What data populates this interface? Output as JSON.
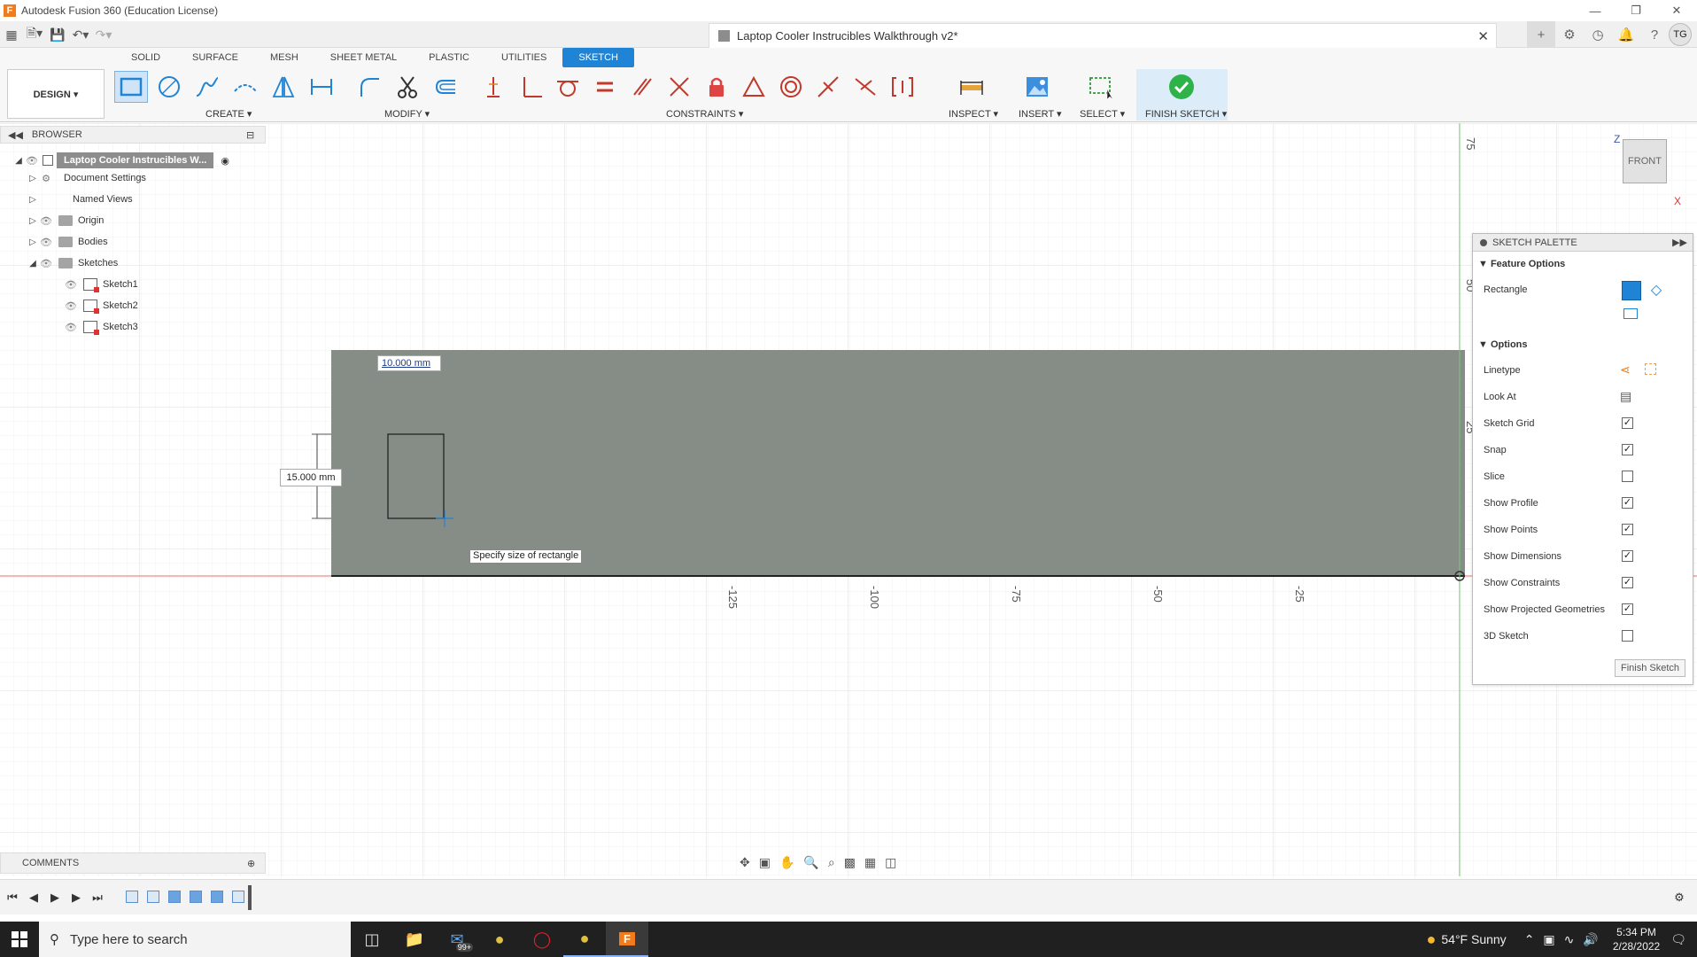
{
  "window": {
    "app_title": "Autodesk Fusion 360 (Education License)",
    "logo_letter": "F",
    "doc_title": "Laptop Cooler Instrucibles Walkthrough v2*",
    "user_initials": "TG"
  },
  "ribbon": {
    "workspace_tabs": [
      "SOLID",
      "SURFACE",
      "MESH",
      "SHEET METAL",
      "PLASTIC",
      "UTILITIES",
      "SKETCH"
    ],
    "active_tab": "SKETCH",
    "design_label": "DESIGN ▾",
    "groups": {
      "create": "CREATE ▾",
      "modify": "MODIFY ▾",
      "constraints": "CONSTRAINTS ▾",
      "inspect": "INSPECT ▾",
      "insert": "INSERT ▾",
      "select": "SELECT ▾",
      "finish": "FINISH SKETCH ▾"
    }
  },
  "browser": {
    "header": "BROWSER",
    "root": "Laptop Cooler Instrucibles W...",
    "items": [
      "Document Settings",
      "Named Views",
      "Origin",
      "Bodies",
      "Sketches"
    ],
    "sketches": [
      "Sketch1",
      "Sketch2",
      "Sketch3"
    ]
  },
  "canvas": {
    "dim_width": "10.000 mm",
    "dim_height": "15.000 mm",
    "tooltip": "Specify size of rectangle",
    "x_ticks": [
      "-125",
      "-100",
      "-75",
      "-50",
      "-25"
    ],
    "y_ticks": [
      "75",
      "50",
      "25"
    ],
    "view_cube": "FRONT",
    "axis_z": "Z",
    "axis_x": "X"
  },
  "palette": {
    "header": "SKETCH PALETTE",
    "feature_options": "Feature Options",
    "rectangle_label": "Rectangle",
    "options_label": "Options",
    "rows": [
      {
        "label": "Linetype",
        "type": "icons"
      },
      {
        "label": "Look At",
        "type": "icon"
      },
      {
        "label": "Sketch Grid",
        "checked": true
      },
      {
        "label": "Snap",
        "checked": true
      },
      {
        "label": "Slice",
        "checked": false
      },
      {
        "label": "Show Profile",
        "checked": true
      },
      {
        "label": "Show Points",
        "checked": true
      },
      {
        "label": "Show Dimensions",
        "checked": true
      },
      {
        "label": "Show Constraints",
        "checked": true
      },
      {
        "label": "Show Projected Geometries",
        "checked": true
      },
      {
        "label": "3D Sketch",
        "checked": false
      }
    ],
    "finish_button": "Finish Sketch"
  },
  "comments": {
    "label": "COMMENTS"
  },
  "taskbar": {
    "search_placeholder": "Type here to search",
    "badge": "99+",
    "weather": "54°F  Sunny",
    "time": "5:34 PM",
    "date": "2/28/2022"
  },
  "colors": {
    "accent": "#1f84d6",
    "profile_fill": "#7f8680",
    "finish_green": "#2fb24a",
    "taskbar": "#202020"
  }
}
